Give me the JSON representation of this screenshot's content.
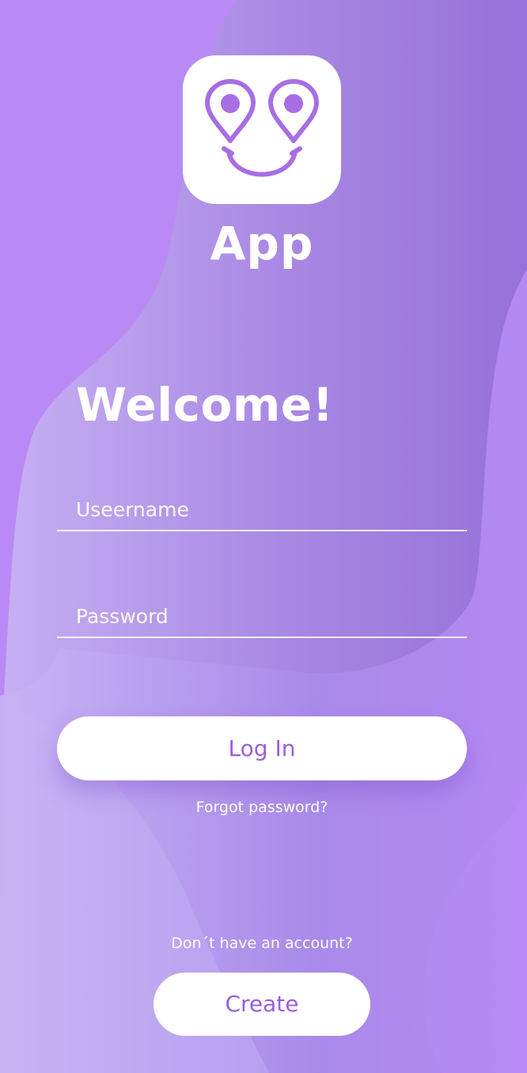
{
  "app": {
    "name": "App"
  },
  "welcome": {
    "title": "Welcome!"
  },
  "form": {
    "username_placeholder": "Useername",
    "password_placeholder": "Password",
    "login_label": "Log In",
    "forgot_label": "Forgot password?"
  },
  "signup": {
    "prompt": "Don´t have an account?",
    "create_label": "Create"
  },
  "colors": {
    "background": "#b98af5",
    "accent": "#9d5ed8",
    "logo_stroke": "#a86ee3"
  },
  "icons": {
    "logo": "map-pins-smiley-icon"
  }
}
